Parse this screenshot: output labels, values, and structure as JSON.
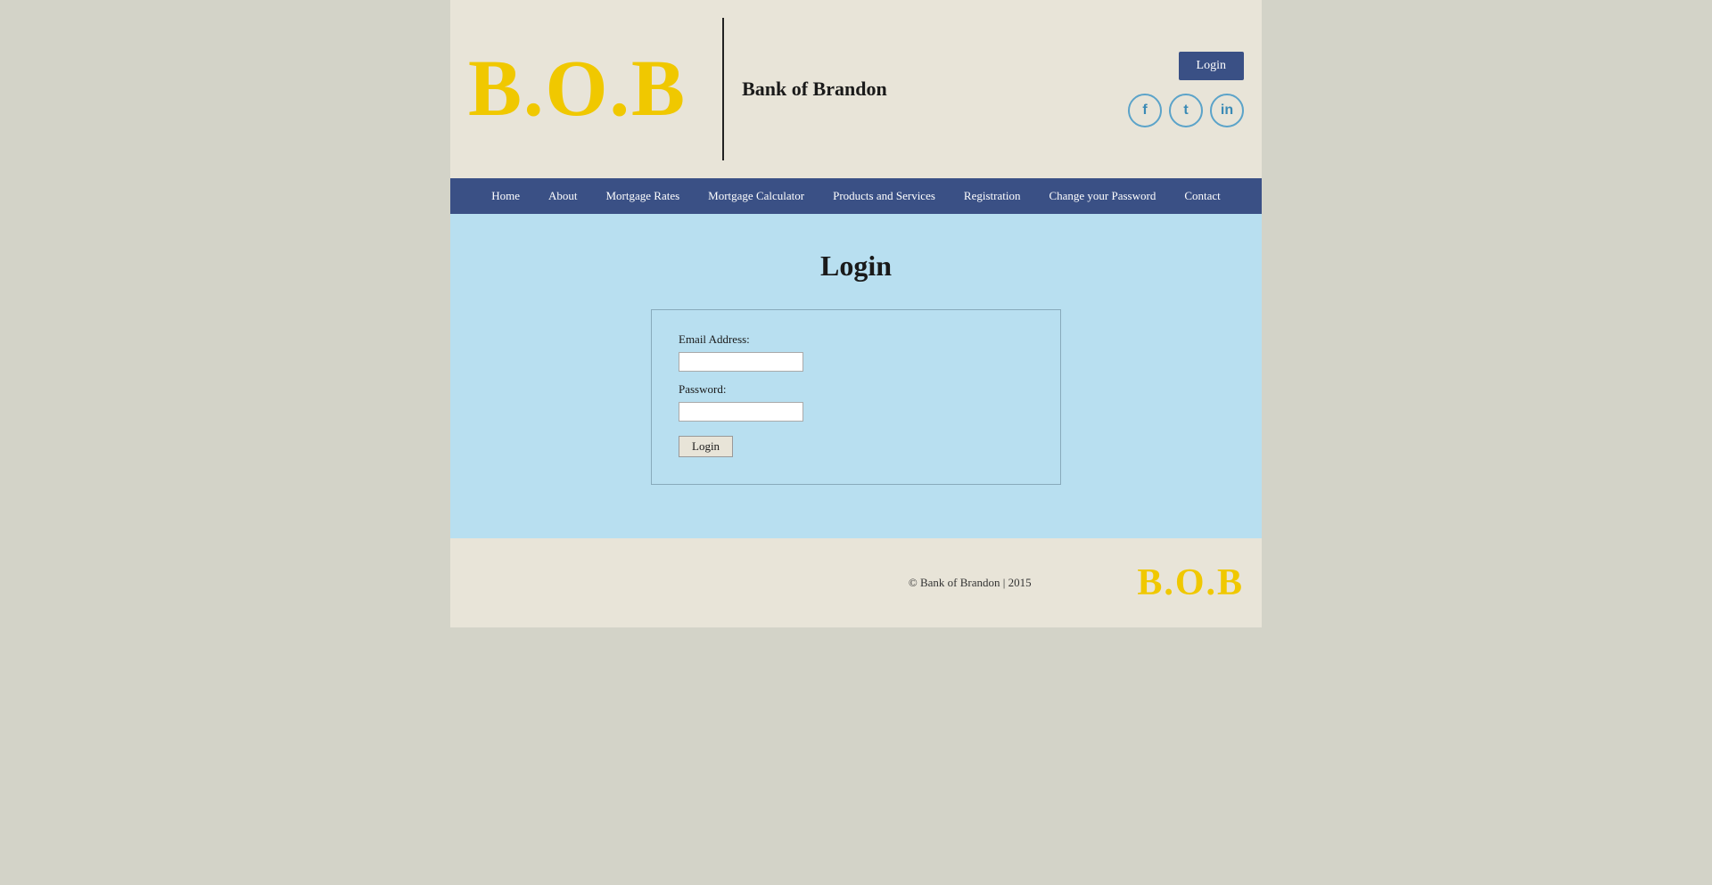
{
  "header": {
    "logo": "B.O.B",
    "bank_name": "Bank of Brandon",
    "login_button": "Login",
    "social": {
      "facebook": "f",
      "twitter": "t",
      "linkedin": "in"
    }
  },
  "navbar": {
    "items": [
      {
        "label": "Home",
        "name": "home"
      },
      {
        "label": "About",
        "name": "about"
      },
      {
        "label": "Mortgage Rates",
        "name": "mortgage-rates"
      },
      {
        "label": "Mortgage Calculator",
        "name": "mortgage-calculator"
      },
      {
        "label": "Products and Services",
        "name": "products-services"
      },
      {
        "label": "Registration",
        "name": "registration"
      },
      {
        "label": "Change your Password",
        "name": "change-password"
      },
      {
        "label": "Contact",
        "name": "contact"
      }
    ]
  },
  "main": {
    "page_title": "Login",
    "form": {
      "email_label": "Email Address:",
      "password_label": "Password:",
      "submit_label": "Login"
    }
  },
  "footer": {
    "copyright": "© Bank of Brandon | 2015",
    "logo": "B.O.B"
  }
}
